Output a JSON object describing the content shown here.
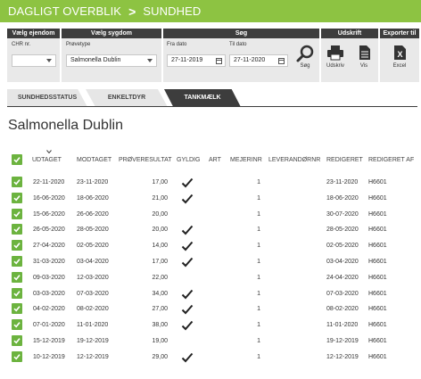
{
  "breadcrumb": {
    "root": "DAGLIGT OVERBLIK",
    "separator": ">",
    "current": "SUNDHED"
  },
  "filters": {
    "ejendom": {
      "header": "Vælg ejendom",
      "label": "CHR nr.",
      "value": ""
    },
    "sygdom": {
      "header": "Vælg sygdom",
      "label": "Prøvetype",
      "value": "Salmonella Dublin"
    },
    "soeg": {
      "header": "Søg",
      "fra_label": "Fra dato",
      "fra_value": "27-11-2019",
      "til_label": "Til dato",
      "til_value": "27-11-2020",
      "button_label": "Søg"
    },
    "udskrift": {
      "header": "Udskrift",
      "udskriv_label": "Udskriv",
      "vis_label": "Vis"
    },
    "exporter": {
      "header": "Exporter til",
      "excel_label": "Excel"
    }
  },
  "tabs": [
    {
      "label": "SUNDHEDSSTATUS",
      "active": false
    },
    {
      "label": "ENKELTDYR",
      "active": false
    },
    {
      "label": "TANKMÆLK",
      "active": true
    }
  ],
  "page_title": "Salmonella Dublin",
  "table": {
    "columns": [
      "UDTAGET",
      "MODTAGET",
      "PRØVERESULTAT",
      "GYLDIG",
      "ART",
      "MEJERINR",
      "LEVERANDØRNR",
      "REDIGERET",
      "REDIGERET AF"
    ],
    "rows": [
      {
        "udtaget": "22-11-2020",
        "modtaget": "23-11-2020",
        "resultat": "17,00",
        "gyldig": true,
        "mejerinr": "1",
        "redigeret": "23-11-2020",
        "redigeret_af": "H6601"
      },
      {
        "udtaget": "16-06-2020",
        "modtaget": "18-06-2020",
        "resultat": "21,00",
        "gyldig": true,
        "mejerinr": "1",
        "redigeret": "18-06-2020",
        "redigeret_af": "H6601"
      },
      {
        "udtaget": "15-06-2020",
        "modtaget": "26-06-2020",
        "resultat": "20,00",
        "gyldig": false,
        "mejerinr": "1",
        "redigeret": "30-07-2020",
        "redigeret_af": "H6601"
      },
      {
        "udtaget": "26-05-2020",
        "modtaget": "28-05-2020",
        "resultat": "20,00",
        "gyldig": true,
        "mejerinr": "1",
        "redigeret": "28-05-2020",
        "redigeret_af": "H6601"
      },
      {
        "udtaget": "27-04-2020",
        "modtaget": "02-05-2020",
        "resultat": "14,00",
        "gyldig": true,
        "mejerinr": "1",
        "redigeret": "02-05-2020",
        "redigeret_af": "H6601"
      },
      {
        "udtaget": "31-03-2020",
        "modtaget": "03-04-2020",
        "resultat": "17,00",
        "gyldig": true,
        "mejerinr": "1",
        "redigeret": "03-04-2020",
        "redigeret_af": "H6601"
      },
      {
        "udtaget": "09-03-2020",
        "modtaget": "12-03-2020",
        "resultat": "22,00",
        "gyldig": false,
        "mejerinr": "1",
        "redigeret": "24-04-2020",
        "redigeret_af": "H6601"
      },
      {
        "udtaget": "03-03-2020",
        "modtaget": "07-03-2020",
        "resultat": "34,00",
        "gyldig": true,
        "mejerinr": "1",
        "redigeret": "07-03-2020",
        "redigeret_af": "H6601"
      },
      {
        "udtaget": "04-02-2020",
        "modtaget": "08-02-2020",
        "resultat": "27,00",
        "gyldig": true,
        "mejerinr": "1",
        "redigeret": "08-02-2020",
        "redigeret_af": "H6601"
      },
      {
        "udtaget": "07-01-2020",
        "modtaget": "11-01-2020",
        "resultat": "38,00",
        "gyldig": true,
        "mejerinr": "1",
        "redigeret": "11-01-2020",
        "redigeret_af": "H6601"
      },
      {
        "udtaget": "15-12-2019",
        "modtaget": "19-12-2019",
        "resultat": "19,00",
        "gyldig": false,
        "mejerinr": "1",
        "redigeret": "19-12-2019",
        "redigeret_af": "H6601"
      },
      {
        "udtaget": "10-12-2019",
        "modtaget": "12-12-2019",
        "resultat": "29,00",
        "gyldig": true,
        "mejerinr": "1",
        "redigeret": "12-12-2019",
        "redigeret_af": "H6601"
      }
    ]
  },
  "colors": {
    "header_green": "#8dc342",
    "checkbox_green": "#6cb33f",
    "panel_dark": "#3d3d3d"
  }
}
